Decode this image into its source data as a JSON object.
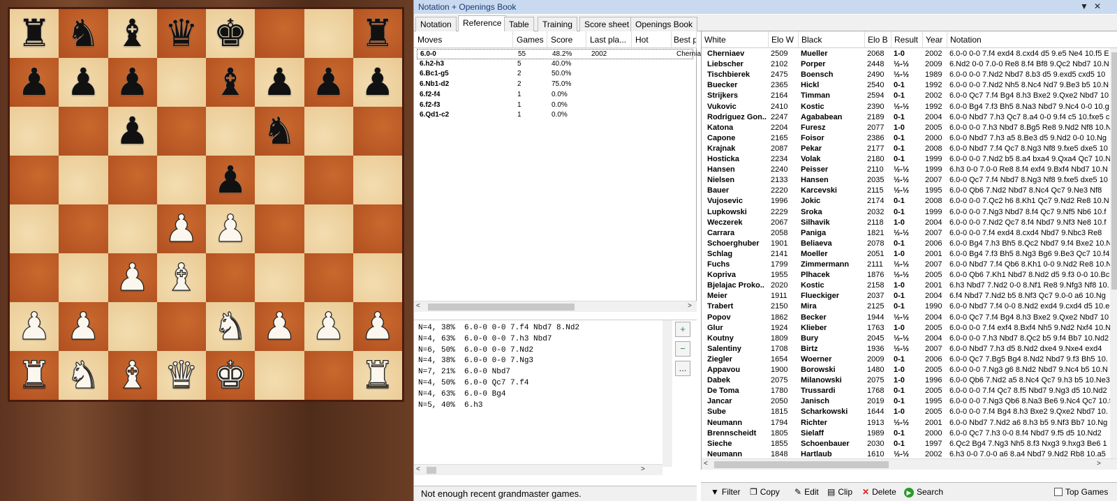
{
  "board": {
    "squares": [
      [
        "br",
        "bn",
        "bb",
        "bq",
        "bk",
        "",
        "",
        "br"
      ],
      [
        "bp",
        "bp",
        "bp",
        "",
        "bb",
        "bp",
        "bp",
        "bp"
      ],
      [
        "",
        "",
        "bp",
        "",
        "",
        "bn",
        "",
        ""
      ],
      [
        "",
        "",
        "",
        "",
        "bp",
        "",
        "",
        ""
      ],
      [
        "",
        "",
        "",
        "wp",
        "wp",
        "",
        "",
        ""
      ],
      [
        "",
        "",
        "wp",
        "wb",
        "",
        "",
        "",
        ""
      ],
      [
        "wp",
        "wp",
        "",
        "",
        "wn",
        "wp",
        "wp",
        "wp"
      ],
      [
        "wr",
        "wn",
        "wb",
        "wq",
        "wk",
        "",
        "",
        "wr"
      ]
    ]
  },
  "window": {
    "title": "Notation + Openings Book"
  },
  "tabs": [
    "Notation",
    "Reference",
    "Table",
    "Training",
    "Score sheet",
    "Openings Book"
  ],
  "moves_table": {
    "headers": [
      "Moves",
      "Games",
      "Score",
      "Last pla...",
      "Hot",
      "Best players"
    ],
    "rows": [
      [
        "6.0-0",
        "55",
        "48.2%",
        "2002",
        "",
        "Cherniaev"
      ],
      [
        "6.h2-h3",
        "5",
        "40.0%",
        "",
        "",
        ""
      ],
      [
        "6.Bc1-g5",
        "2",
        "50.0%",
        "",
        "",
        ""
      ],
      [
        "6.Nb1-d2",
        "2",
        "75.0%",
        "",
        "",
        ""
      ],
      [
        "6.f2-f4",
        "1",
        "0.0%",
        "",
        "",
        ""
      ],
      [
        "6.f2-f3",
        "1",
        "0.0%",
        "",
        "",
        ""
      ],
      [
        "6.Qd1-c2",
        "1",
        "0.0%",
        "",
        "",
        ""
      ]
    ]
  },
  "notes": [
    "N=4, 38%  6.0-0 0-0 7.f4 Nbd7 8.Nd2",
    "N=4, 63%  6.0-0 0-0 7.h3 Nbd7",
    "N=6, 50%  6.0-0 0-0 7.Nd2",
    "N=4, 38%  6.0-0 0-0 7.Ng3",
    "N=7, 21%  6.0-0 Nbd7",
    "N=4, 50%  6.0-0 Qc7 7.f4",
    "N=4, 63%  6.0-0 Bg4",
    "N=5, 40%  6.h3"
  ],
  "zoom": {
    "in": "+",
    "out": "−",
    "more": "..."
  },
  "status": "Not enough recent grandmaster games.",
  "games_table": {
    "headers": [
      "White",
      "Elo W",
      "Black",
      "Elo B",
      "Result",
      "Year",
      "Notation"
    ],
    "rows": [
      [
        "Cherniaev",
        "2509",
        "Mueller",
        "2068",
        "1-0",
        "2002",
        "6.0-0 0-0 7.f4 exd4 8.cxd4 d5 9.e5 Ne4 10.f5 E"
      ],
      [
        "Liebscher",
        "2102",
        "Porper",
        "2448",
        "½-½",
        "2009",
        "6.Nd2 0-0 7.0-0 Re8 8.f4 Bf8 9.Qc2 Nbd7 10.N"
      ],
      [
        "Tischbierek",
        "2475",
        "Boensch",
        "2490",
        "½-½",
        "1989",
        "6.0-0 0-0 7.Nd2 Nbd7 8.b3 d5 9.exd5 cxd5 10"
      ],
      [
        "Buecker",
        "2365",
        "Hickl",
        "2540",
        "0-1",
        "1992",
        "6.0-0 0-0 7.Nd2 Nh5 8.Nc4 Nd7 9.Be3 b5 10.N"
      ],
      [
        "Strijkers",
        "2164",
        "Timman",
        "2594",
        "0-1",
        "2002",
        "6.0-0 Qc7 7.f4 Bg4 8.h3 Bxe2 9.Qxe2 Nbd7 10"
      ],
      [
        "Vukovic",
        "2410",
        "Kostic",
        "2390",
        "½-½",
        "1992",
        "6.0-0 Bg4 7.f3 Bh5 8.Na3 Nbd7 9.Nc4 0-0 10.g"
      ],
      [
        "Rodriguez Gon..",
        "2247",
        "Agababean",
        "2189",
        "0-1",
        "2004",
        "6.0-0 Nbd7 7.h3 Qc7 8.a4 0-0 9.f4 c5 10.fxe5 c"
      ],
      [
        "Katona",
        "2204",
        "Furesz",
        "2077",
        "1-0",
        "2005",
        "6.0-0 0-0 7.h3 Nbd7 8.Bg5 Re8 9.Nd2 Nf8 10.N"
      ],
      [
        "Capone",
        "2165",
        "Foisor",
        "2386",
        "0-1",
        "2000",
        "6.0-0 Nbd7 7.h3 a5 8.Be3 d5 9.Nd2 0-0 10.Ng"
      ],
      [
        "Krajnak",
        "2087",
        "Pekar",
        "2177",
        "0-1",
        "2008",
        "6.0-0 Nbd7 7.f4 Qc7 8.Ng3 Nf8 9.fxe5 dxe5 10"
      ],
      [
        "Hosticka",
        "2234",
        "Volak",
        "2180",
        "0-1",
        "1999",
        "6.0-0 0-0 7.Nd2 b5 8.a4 bxa4 9.Qxa4 Qc7 10.N"
      ],
      [
        "Hansen",
        "2240",
        "Peisser",
        "2110",
        "½-½",
        "1999",
        "6.h3 0-0 7.0-0 Re8 8.f4 exf4 9.Bxf4 Nbd7 10.N"
      ],
      [
        "Nielsen",
        "2133",
        "Hansen",
        "2035",
        "½-½",
        "2007",
        "6.0-0 Qc7 7.f4 Nbd7 8.Ng3 Nf8 9.fxe5 dxe5 10"
      ],
      [
        "Bauer",
        "2220",
        "Karcevski",
        "2115",
        "½-½",
        "1995",
        "6.0-0 Qb6 7.Nd2 Nbd7 8.Nc4 Qc7 9.Ne3 Nf8"
      ],
      [
        "Vujosevic",
        "1996",
        "Jokic",
        "2174",
        "0-1",
        "2008",
        "6.0-0 0-0 7.Qc2 h6 8.Kh1 Qc7 9.Nd2 Re8 10.N"
      ],
      [
        "Lupkowski",
        "2229",
        "Sroka",
        "2032",
        "0-1",
        "1999",
        "6.0-0 0-0 7.Ng3 Nbd7 8.f4 Qc7 9.Nf5 Nb6 10.f"
      ],
      [
        "Weczerek",
        "2067",
        "Silhavik",
        "2118",
        "1-0",
        "2004",
        "6.0-0 0-0 7.Nd2 Qc7 8.f4 Nbd7 9.Nf3 Ne8 10.f"
      ],
      [
        "Carrara",
        "2058",
        "Paniga",
        "1821",
        "½-½",
        "2007",
        "6.0-0 0-0 7.f4 exd4 8.cxd4 Nbd7 9.Nbc3 Re8"
      ],
      [
        "Schoerghuber",
        "1901",
        "Beliaeva",
        "2078",
        "0-1",
        "2006",
        "6.0-0 Bg4 7.h3 Bh5 8.Qc2 Nbd7 9.f4 Bxe2 10.N"
      ],
      [
        "Schlag",
        "2141",
        "Moeller",
        "2051",
        "1-0",
        "2001",
        "6.0-0 Bg4 7.f3 Bh5 8.Ng3 Bg6 9.Be3 Qc7 10.f4"
      ],
      [
        "Fuchs",
        "1799",
        "Zimmermann",
        "2111",
        "½-½",
        "2007",
        "6.0-0 Nbd7 7.f4 Qb6 8.Kh1 0-0 9.Nd2 Re8 10.N"
      ],
      [
        "Kopriva",
        "1955",
        "Plhacek",
        "1876",
        "½-½",
        "2005",
        "6.0-0 Qb6 7.Kh1 Nbd7 8.Nd2 d5 9.f3 0-0 10.Bc"
      ],
      [
        "Bjelajac Proko..",
        "2020",
        "Kostic",
        "2158",
        "1-0",
        "2001",
        "6.h3 Nbd7 7.Nd2 0-0 8.Nf1 Re8 9.Nfg3 Nf8 10."
      ],
      [
        "Meier",
        "1911",
        "Flueckiger",
        "2037",
        "0-1",
        "2004",
        "6.f4 Nbd7 7.Nd2 b5 8.Nf3 Qc7 9.0-0 a6 10.Ng"
      ],
      [
        "Trabert",
        "2150",
        "Mira",
        "2125",
        "0-1",
        "1990",
        "6.0-0 Nbd7 7.f4 0-0 8.Nd2 exd4 9.cxd4 d5 10.e"
      ],
      [
        "Popov",
        "1862",
        "Becker",
        "1944",
        "½-½",
        "2004",
        "6.0-0 Qc7 7.f4 Bg4 8.h3 Bxe2 9.Qxe2 Nbd7 10"
      ],
      [
        "Glur",
        "1924",
        "Klieber",
        "1763",
        "1-0",
        "2005",
        "6.0-0 0-0 7.f4 exf4 8.Bxf4 Nh5 9.Nd2 Nxf4 10.N"
      ],
      [
        "Koutny",
        "1809",
        "Bury",
        "2045",
        "½-½",
        "2004",
        "6.0-0 0-0 7.h3 Nbd7 8.Qc2 b5 9.f4 Bb7 10.Nd2"
      ],
      [
        "Salentiny",
        "1708",
        "Birtz",
        "1936",
        "½-½",
        "2007",
        "6.0-0 Nbd7 7.h3 d5 8.Nd2 dxe4 9.Nxe4 exd4"
      ],
      [
        "Ziegler",
        "1654",
        "Woerner",
        "2009",
        "0-1",
        "2006",
        "6.0-0 Qc7 7.Bg5 Bg4 8.Nd2 Nbd7 9.f3 Bh5 10."
      ],
      [
        "Appavou",
        "1900",
        "Borowski",
        "1480",
        "1-0",
        "2005",
        "6.0-0 0-0 7.Ng3 g6 8.Nd2 Nbd7 9.Nc4 b5 10.N"
      ],
      [
        "Dabek",
        "2075",
        "Milanowski",
        "2075",
        "1-0",
        "1996",
        "6.0-0 Qb6 7.Nd2 a5 8.Nc4 Qc7 9.h3 b5 10.Ne3"
      ],
      [
        "De Toma",
        "1780",
        "Trussardi",
        "1768",
        "0-1",
        "2005",
        "6.0-0 0-0 7.f4 Qc7 8.f5 Nbd7 9.Ng3 d5 10.Nd2"
      ],
      [
        "Jancar",
        "2050",
        "Janisch",
        "2019",
        "0-1",
        "1995",
        "6.0-0 0-0 7.Ng3 Qb6 8.Na3 Be6 9.Nc4 Qc7 10.f"
      ],
      [
        "Sube",
        "1815",
        "Scharkowski",
        "1644",
        "1-0",
        "2005",
        "6.0-0 0-0 7.f4 Bg4 8.h3 Bxe2 9.Qxe2 Nbd7 10."
      ],
      [
        "Neumann",
        "1794",
        "Richter",
        "1913",
        "½-½",
        "2001",
        "6.0-0 Nbd7 7.Nd2 a6 8.h3 b5 9.Nf3 Bb7 10.Ng"
      ],
      [
        "Brennscheidt",
        "1805",
        "Sielaff",
        "1989",
        "0-1",
        "2000",
        "6.0-0 Qc7 7.h3 0-0 8.f4 Nbd7 9.f5 d5 10.Nd2"
      ],
      [
        "Sieche",
        "1855",
        "Schoenbauer",
        "2030",
        "0-1",
        "1997",
        "6.Qc2 Bg4 7.Ng3 Nh5 8.f3 Nxg3 9.hxg3 Be6 1"
      ],
      [
        "Neumann",
        "1848",
        "Hartlaub",
        "1610",
        "½-½",
        "2002",
        "6.h3 0-0 7.0-0 a6 8.a4 Nbd7 9.Nd2 Rb8 10.a5"
      ]
    ]
  },
  "toolbar": {
    "filter": "Filter",
    "copy": "Copy",
    "edit": "Edit",
    "clip": "Clip",
    "delete": "Delete",
    "search": "Search",
    "top_games": "Top Games"
  },
  "icons": {
    "filter": "funnel-icon",
    "copy": "copy-icon",
    "edit": "edit-icon",
    "clip": "clipboard-icon",
    "delete": "delete-x-icon",
    "search": "green-play-icon"
  },
  "colors": {
    "light_square": "#f0d7a8",
    "dark_square": "#b8582a",
    "title_bar": "#c9daf0",
    "delete_red": "#d22",
    "search_green": "#2a9a2a"
  }
}
